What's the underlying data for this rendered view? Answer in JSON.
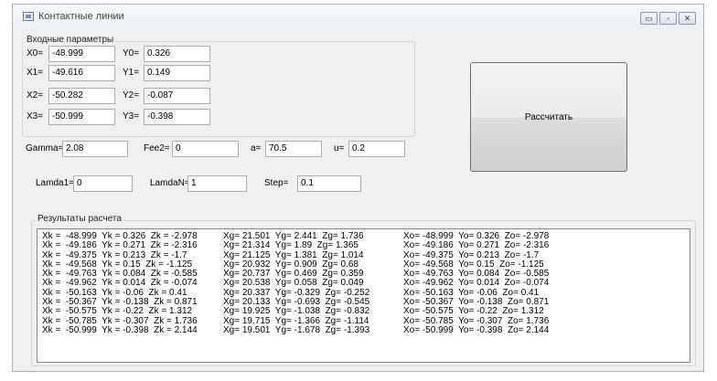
{
  "window": {
    "title": "Контактные линии",
    "controls": {
      "minimize": "▭",
      "maximize": "▫",
      "close": "✕"
    }
  },
  "inputs_group": {
    "label": "Входные параметры",
    "fields": [
      {
        "label": "X0=",
        "value": "-48.999"
      },
      {
        "label": "Y0=",
        "value": "0.326"
      },
      {
        "label": "X1=",
        "value": "-49.616"
      },
      {
        "label": "Y1=",
        "value": "0.149"
      },
      {
        "label": "X2=",
        "value": "-50.282"
      },
      {
        "label": "Y2=",
        "value": "-0.087"
      },
      {
        "label": "X3=",
        "value": "-50.999"
      },
      {
        "label": "Y3=",
        "value": "-0.398"
      }
    ]
  },
  "params": [
    {
      "label": "Gamma=",
      "value": "2.08"
    },
    {
      "label": "Fee2=",
      "value": "0"
    },
    {
      "label": "a=",
      "value": "70.5"
    },
    {
      "label": "u=",
      "value": "0.2"
    },
    {
      "label": "Lamda1=",
      "value": "0"
    },
    {
      "label": "LamdaN=",
      "value": "1"
    },
    {
      "label": "Step=",
      "value": "0.1"
    }
  ],
  "calculate_button": "Рассчитать",
  "results_group": {
    "label": "Результаты расчета",
    "rows": [
      [
        "Xk =  -48.999  Yk = 0.326  Zk = -2.978",
        "Xg= 21.501  Yg= 2.441  Zg= 1.736",
        "Xo= -48.999  Yo= 0.326  Zo= -2.978"
      ],
      [
        "Xk =  -49.186  Yk = 0.271  Zk = -2.316",
        "Xg= 21.314  Yg= 1.89  Zg= 1.365",
        "Xo= -49.186  Yo= 0.271  Zo= -2.316"
      ],
      [
        "Xk =  -49.375  Yk = 0.213  Zk = -1.7",
        "Xg= 21.125  Yg= 1.381  Zg= 1.014",
        "Xo= -49.375  Yo= 0.213  Zo= -1.7"
      ],
      [
        "Xk =  -49.568  Yk = 0.15  Zk = -1.125",
        "Xg= 20.932  Yg= 0.909  Zg= 0.68",
        "Xo= -49.568  Yo= 0.15  Zo= -1.125"
      ],
      [
        "Xk =  -49.763  Yk = 0.084  Zk = -0.585",
        "Xg= 20.737  Yg= 0.469  Zg= 0.359",
        "Xo= -49.763  Yo= 0.084  Zo= -0.585"
      ],
      [
        "Xk =  -49.962  Yk = 0.014  Zk = -0.074",
        "Xg= 20.538  Yg= 0.058  Zg= 0.049",
        "Xo= -49.962  Yo= 0.014  Zo= -0.074"
      ],
      [
        "Xk =  -50.163  Yk = -0.06  Zk = 0.41",
        "Xg= 20.337  Yg= -0.329  Zg= -0.252",
        "Xo= -50.163  Yo= -0.06  Zo= 0.41"
      ],
      [
        "Xk =  -50.367  Yk = -0.138  Zk = 0.871",
        "Xg= 20.133  Yg= -0.693  Zg= -0.545",
        "Xo= -50.367  Yo= -0.138  Zo= 0.871"
      ],
      [
        "Xk =  -50.575  Yk = -0.22  Zk = 1.312",
        "Xg= 19.925  Yg= -1.038  Zg= -0.832",
        "Xo= -50.575  Yo= -0.22  Zo= 1.312"
      ],
      [
        "Xk =  -50.785  Yk = -0.307  Zk = 1.736",
        "Xg= 19.715  Yg= -1.366  Zg= -1.114",
        "Xo= -50.785  Yo= -0.307  Zo= 1.736"
      ],
      [
        "Xk =  -50.999  Yk = -0.398  Zk = 2.144",
        "Xg= 19.501  Yg= -1.678  Zg= -1.393",
        "Xo= -50.999  Yo= -0.398  Zo= 2.144"
      ]
    ]
  }
}
